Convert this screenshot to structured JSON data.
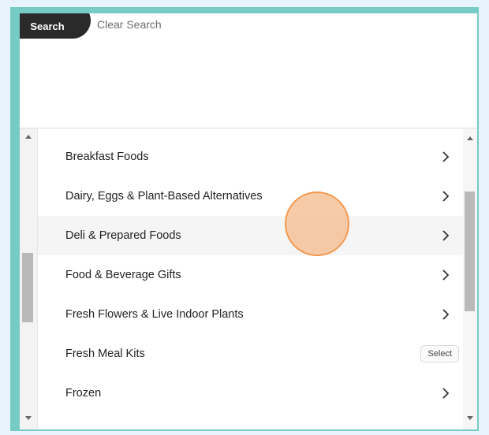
{
  "header": {
    "search_label": "Search",
    "clear_label": "Clear Search"
  },
  "categories": [
    {
      "label": "Breakfast Foods",
      "action": "chevron"
    },
    {
      "label": "Dairy, Eggs & Plant-Based Alternatives",
      "action": "chevron"
    },
    {
      "label": "Deli & Prepared Foods",
      "action": "chevron"
    },
    {
      "label": "Food & Beverage Gifts",
      "action": "chevron"
    },
    {
      "label": "Fresh Flowers & Live Indoor Plants",
      "action": "chevron"
    },
    {
      "label": "Fresh Meal Kits",
      "action": "select"
    },
    {
      "label": "Frozen",
      "action": "chevron"
    }
  ],
  "select_label": "Select",
  "colors": {
    "frame": "#76ccc4",
    "background": "#e8f4fb",
    "cursor": "#f29a52"
  }
}
